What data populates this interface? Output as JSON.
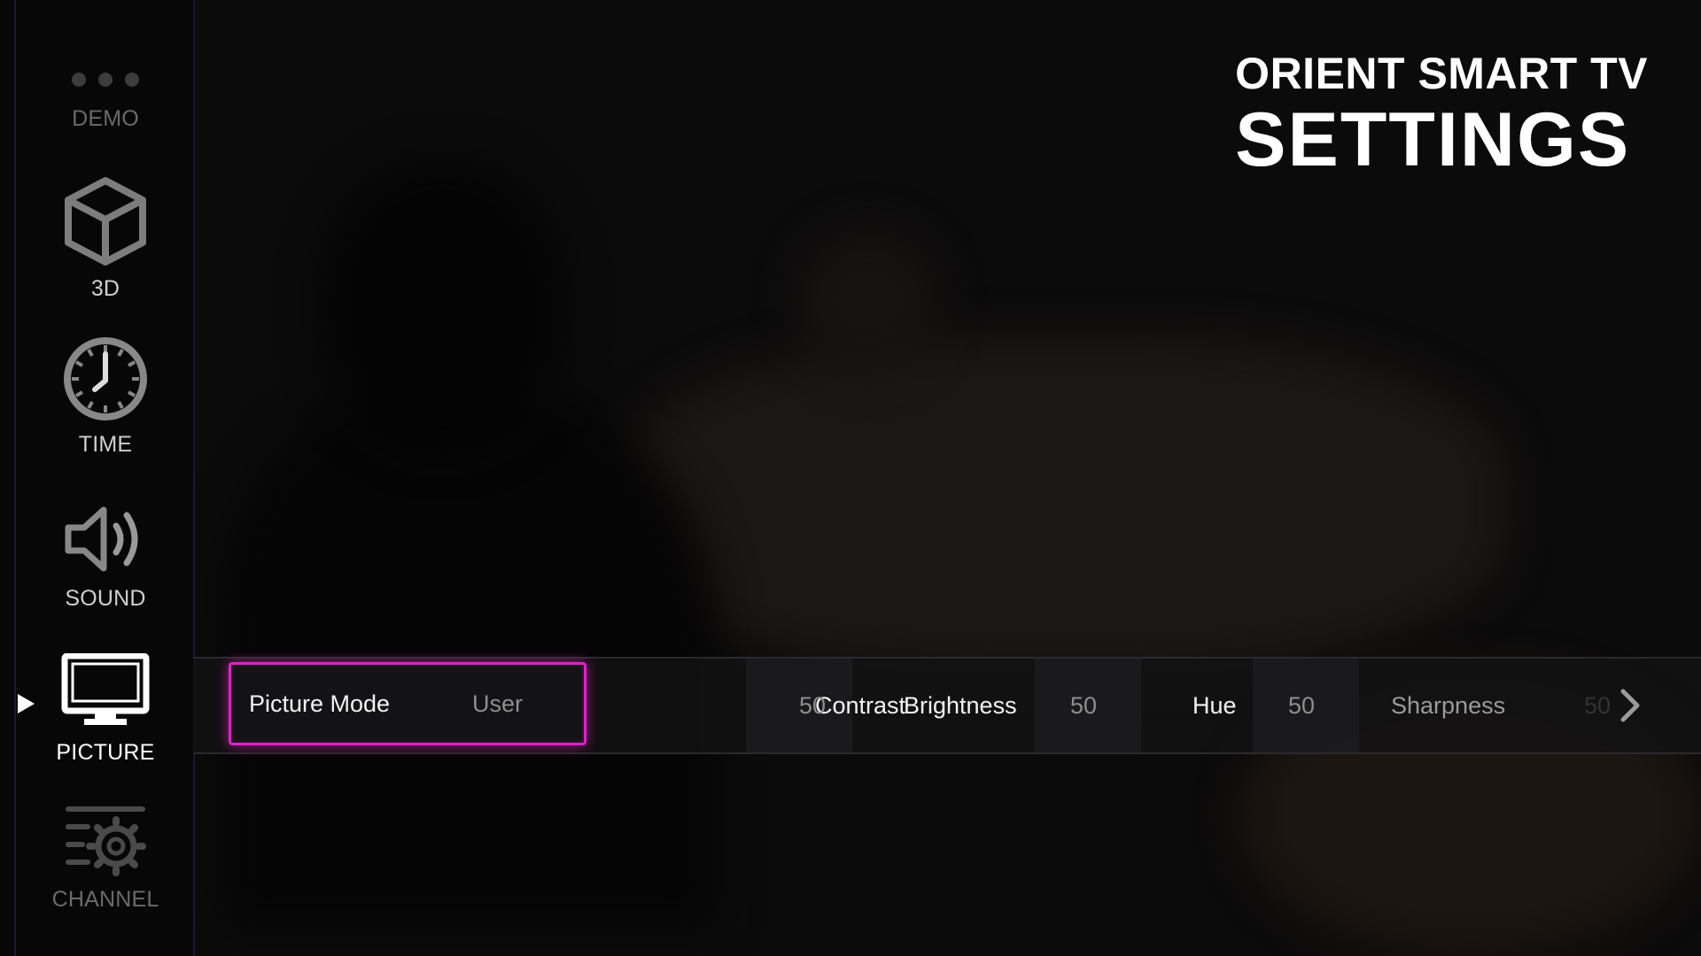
{
  "header": {
    "brand": "ORIENT SMART TV",
    "title": "SETTINGS"
  },
  "sidebar": {
    "items": [
      {
        "label": "DEMO",
        "icon": "dots-icon",
        "state": "dim"
      },
      {
        "label": "3D",
        "icon": "cube-icon",
        "state": "normal"
      },
      {
        "label": "TIME",
        "icon": "clock-icon",
        "state": "normal"
      },
      {
        "label": "SOUND",
        "icon": "speaker-icon",
        "state": "normal"
      },
      {
        "label": "PICTURE",
        "icon": "monitor-icon",
        "state": "selected"
      },
      {
        "label": "CHANNEL",
        "icon": "channel-settings-icon",
        "state": "dim"
      }
    ]
  },
  "picture_settings": [
    {
      "name": "Picture Mode",
      "value": "User",
      "focused": true
    },
    {
      "name": "Contrast",
      "value": "50"
    },
    {
      "name": "Brightness",
      "value": "50"
    },
    {
      "name": "Hue",
      "value": "50"
    },
    {
      "name": "Sharpness",
      "value": "50"
    }
  ],
  "colors": {
    "focus_border": "#e020c8",
    "accent_line": "#3c3878"
  },
  "icons": {
    "next": "chevron-right-icon",
    "selection_pointer": "play-arrow-icon"
  }
}
